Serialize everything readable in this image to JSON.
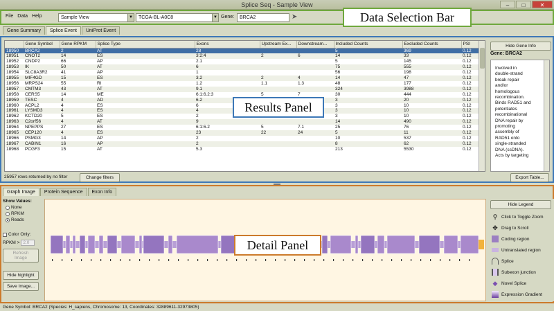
{
  "window": {
    "title": "Splice Seq - Sample View",
    "controls": [
      "–",
      "□",
      "✕"
    ]
  },
  "menu": [
    "File",
    "Data",
    "Help"
  ],
  "toolbar": {
    "view": "Sample View",
    "sample": "TCGA-BL-A0C8",
    "gene_label": "Gene:",
    "gene": "BRCA2"
  },
  "annotations": {
    "data_selection": "Data Selection Bar",
    "results": "Results Panel",
    "detail": "Detail Panel"
  },
  "top_tabs": [
    "Gene Summary",
    "Splice Event",
    "UniProt Event"
  ],
  "table": {
    "columns": [
      "",
      "Gene Symbol",
      "Gene RPKM",
      "Splice Type",
      "Exons",
      "Upstream Ex...",
      "Downstream...",
      "Included Counts",
      "Excluded Counts",
      "PSI"
    ],
    "rows": [
      [
        "18950",
        "BRCA2",
        "2",
        "AT",
        "28",
        "",
        "",
        "5",
        "369",
        "0.12"
      ],
      [
        "18951",
        "CNOT2",
        "14",
        "ES",
        "3:2:4",
        "2",
        "6",
        "14",
        "33",
        "0.12"
      ],
      [
        "18952",
        "CNDP2",
        "66",
        "AP",
        "2.1",
        "",
        "",
        "5",
        "145",
        "0.12"
      ],
      [
        "18953",
        "IK",
        "50",
        "AT",
        "6",
        "",
        "",
        "75",
        "555",
        "0.12"
      ],
      [
        "18954",
        "SLC8A3R2",
        "41",
        "AP",
        "1",
        "",
        "",
        "56",
        "198",
        "0.12"
      ],
      [
        "18955",
        "MIF4GD",
        "15",
        "ES",
        "3.2",
        "2",
        "4",
        "14",
        "47",
        "0.12"
      ],
      [
        "18956",
        "MRPS24",
        "55",
        "RI",
        "1.2",
        "1.1",
        "1.3",
        "48",
        "177",
        "0.12"
      ],
      [
        "18957",
        "CMTM3",
        "43",
        "AT",
        "9.1",
        "",
        "",
        "324",
        "3988",
        "0.12"
      ],
      [
        "18958",
        "CERS5",
        "14",
        "ME",
        "6:1:6.2:3",
        "5",
        "7",
        "30",
        "444",
        "0.12"
      ],
      [
        "18959",
        "TESC",
        "4",
        "AD",
        "6.2",
        "",
        "",
        "3",
        "20",
        "0.12"
      ],
      [
        "18960",
        "ACPL2",
        "4",
        "ES",
        "6",
        "",
        "",
        "3",
        "10",
        "0.12"
      ],
      [
        "18961",
        "LYSMD3",
        "4",
        "ES",
        "4",
        "3",
        "5.1",
        "3",
        "10",
        "0.12"
      ],
      [
        "18962",
        "KCTD20",
        "5",
        "ES",
        "2",
        "1",
        "3",
        "3",
        "10",
        "0.12"
      ],
      [
        "18963",
        "C2orf56",
        "4",
        "AT",
        "9",
        "",
        "",
        "14",
        "490",
        "0.12"
      ],
      [
        "18964",
        "NPEPPS",
        "27",
        "ES",
        "6:1:6.2",
        "5",
        "7.1",
        "25",
        "76",
        "0.12"
      ],
      [
        "18965",
        "CEP120",
        "4",
        "ES",
        "23",
        "22",
        "24",
        "5",
        "11",
        "0.12"
      ],
      [
        "18966",
        "PSMG3",
        "14",
        "AP",
        "2",
        "",
        "",
        "10",
        "537",
        "0.12"
      ],
      [
        "18967",
        "CABIN1",
        "16",
        "AP",
        "2",
        "",
        "",
        "8",
        "62",
        "0.12"
      ],
      [
        "18968",
        "PCGF3",
        "15",
        "AT",
        "5.3",
        "",
        "",
        "213",
        "5530",
        "0.12"
      ]
    ]
  },
  "rows_returned": "25957 rows returned by no filter",
  "change_filters": "Change filters",
  "export_table": "Export Table...",
  "gene_info": {
    "hide_label": "Hide Gene Info",
    "gene": "Gene: BRCA2",
    "description": [
      "Involved in",
      "double-strand",
      "break repair",
      "and/or",
      "homologous",
      "recombination.",
      "Binds RAD51 and",
      "potentiates",
      "recombinational",
      "DNA repair by",
      "promoting",
      "assembly of",
      "RAD51 onto",
      "single-stranded",
      "DNA (ssDNA).",
      "Acts by targeting"
    ]
  },
  "bottom_tabs": [
    "Graph Image",
    "Protein Sequence",
    "Exon Info"
  ],
  "controls": {
    "show_values": "Show Values:",
    "options": [
      "None",
      "RPKM",
      "Reads"
    ],
    "selected": "Reads",
    "color_only": "Color Only:",
    "rpkm_label": "RPKM >",
    "rpkm_value": "2.0",
    "refresh": "Refresh Image",
    "hide_highlight": "Hide highlight",
    "save_image": "Save Image..."
  },
  "legend": {
    "hide_label": "Hide Legend",
    "items": [
      {
        "label": "Click to Toggle Zoom",
        "icon": "magnify-icon"
      },
      {
        "label": "Drag to Scroll",
        "icon": "move-icon"
      },
      {
        "label": "Coding region",
        "icon": "coding-swatch"
      },
      {
        "label": "Untranslated region",
        "icon": "utr-swatch"
      },
      {
        "label": "Splice",
        "icon": "splice-icon"
      },
      {
        "label": "Subexon junction",
        "icon": "subexon-icon"
      },
      {
        "label": "Novel Splice",
        "icon": "novel-splice-icon"
      },
      {
        "label": "Expression Gradient",
        "icon": "gradient-swatch"
      }
    ]
  },
  "status": "Gene Symbol: BRCA2 (Species: H_sapiens, Chromosome: 13, Coordinates: 32889611-32973805)",
  "colors": {
    "results_border": "#3d78b7",
    "detail_border": "#cc7a2b",
    "data_border": "#6fa83d",
    "coding": "#9b7fc1",
    "selected_row": "#3f6ea5"
  }
}
